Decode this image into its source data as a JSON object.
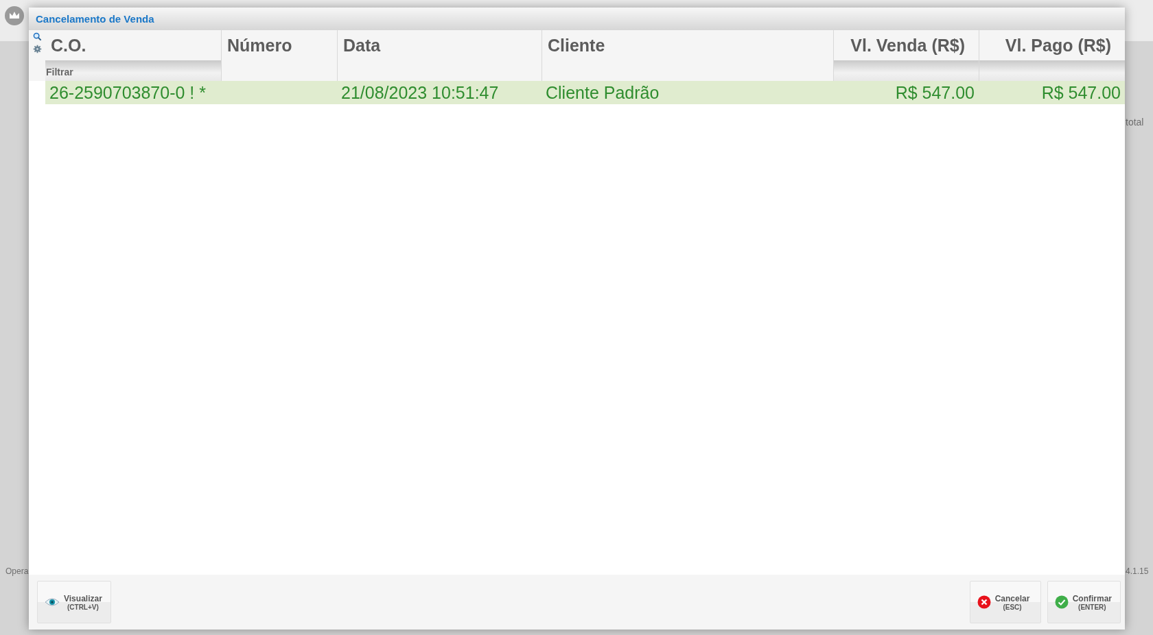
{
  "background": {
    "texts": [
      "Opera",
      "total",
      "4.1.15"
    ]
  },
  "dialog": {
    "title": "Cancelamento de Venda"
  },
  "table": {
    "columns": [
      {
        "label": "C.O.",
        "kind": "filterable",
        "placeholder": "Filtrar"
      },
      {
        "label": "Número",
        "kind": "plain"
      },
      {
        "label": "Data",
        "kind": "plain"
      },
      {
        "label": "Cliente",
        "kind": "plain"
      },
      {
        "label": "Vl. Venda (R$)",
        "kind": "money"
      },
      {
        "label": "Vl. Pago (R$)",
        "kind": "money"
      }
    ],
    "rows": [
      {
        "selected": true,
        "cells": [
          "26-2590703870-0 ! *",
          "",
          "21/08/2023 10:51:47",
          "Cliente Padrão",
          "R$ 547.00",
          "R$ 547.00"
        ]
      }
    ]
  },
  "buttons": [
    {
      "kind": "view",
      "label": "Visualizar",
      "shortcut": "(CTRL+V)"
    },
    {
      "kind": "cancel",
      "label": "Cancelar",
      "shortcut": "(ESC)"
    },
    {
      "kind": "confirm",
      "label": "Confirmar",
      "shortcut": "(ENTER)"
    }
  ]
}
